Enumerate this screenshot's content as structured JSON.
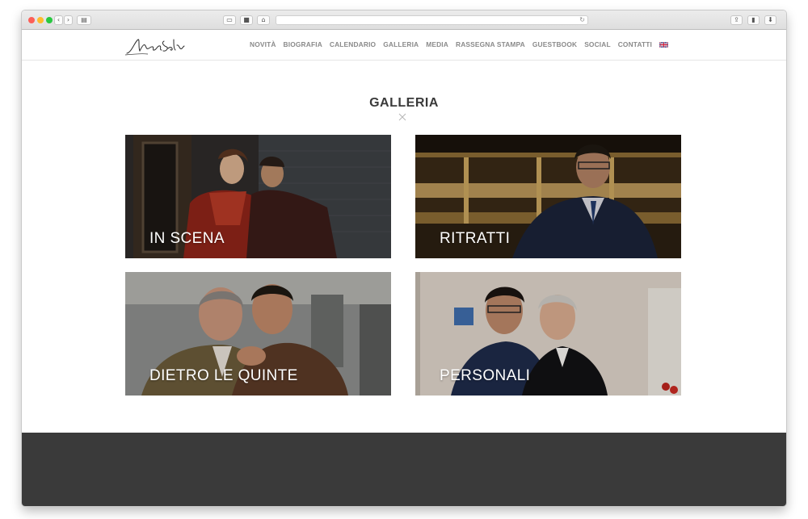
{
  "site": {
    "logo_signature": "Luca Salsi"
  },
  "nav": {
    "items": [
      {
        "label": "NOVITÀ"
      },
      {
        "label": "BIOGRAFIA"
      },
      {
        "label": "CALENDARIO"
      },
      {
        "label": "GALLERIA"
      },
      {
        "label": "MEDIA"
      },
      {
        "label": "RASSEGNA STAMPA"
      },
      {
        "label": "GUESTBOOK"
      },
      {
        "label": "SOCIAL"
      },
      {
        "label": "CONTATTI"
      }
    ],
    "language_flag": "uk-flag-icon"
  },
  "gallery": {
    "title": "GALLERIA",
    "tiles": [
      {
        "label": "IN SCENA"
      },
      {
        "label": "RITRATTI"
      },
      {
        "label": "DIETRO LE QUINTE"
      },
      {
        "label": "PERSONALI"
      }
    ]
  },
  "colors": {
    "nav_text": "#8a8a8a",
    "title_text": "#3a3a3a",
    "footer_bg": "#3a3a3a"
  }
}
